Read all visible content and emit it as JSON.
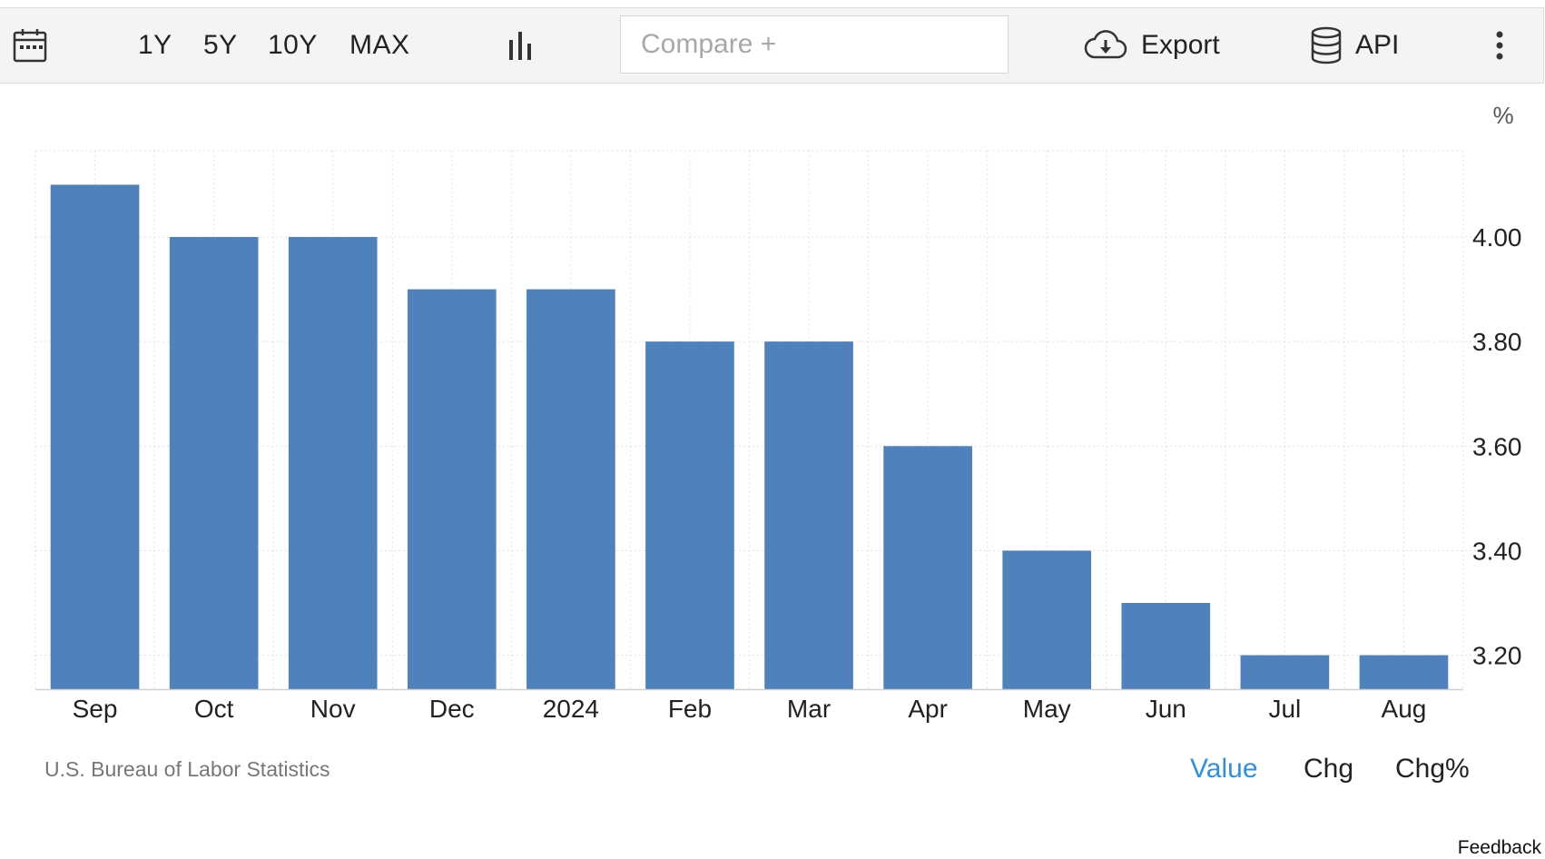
{
  "toolbar": {
    "ranges": [
      "1Y",
      "5Y",
      "10Y",
      "MAX"
    ],
    "compare_placeholder": "Compare +",
    "export_label": "Export",
    "api_label": "API",
    "icons": [
      "calendar-icon",
      "bar-chart-icon",
      "cloud-download-icon",
      "database-icon",
      "more-vertical-icon"
    ]
  },
  "footer": {
    "source": "U.S. Bureau of Labor Statistics",
    "tabs": [
      {
        "label": "Value",
        "active": true
      },
      {
        "label": "Chg",
        "active": false
      },
      {
        "label": "Chg%",
        "active": false
      }
    ],
    "feedback": "Feedback"
  },
  "colors": {
    "bar": "#4f81bd",
    "active_tab": "#2f8fe0"
  },
  "chart_data": {
    "type": "bar",
    "unit": "%",
    "categories": [
      "Sep",
      "Oct",
      "Nov",
      "Dec",
      "2024",
      "Feb",
      "Mar",
      "Apr",
      "May",
      "Jun",
      "Jul",
      "Aug"
    ],
    "values": [
      4.1,
      4.0,
      4.0,
      3.9,
      3.9,
      3.8,
      3.8,
      3.6,
      3.4,
      3.3,
      3.2,
      3.2
    ],
    "yticks": [
      "3.20",
      "3.40",
      "3.60",
      "3.80",
      "4.00"
    ],
    "ylim": [
      3.135,
      4.165
    ],
    "grid": true,
    "y_axis_side": "right"
  }
}
